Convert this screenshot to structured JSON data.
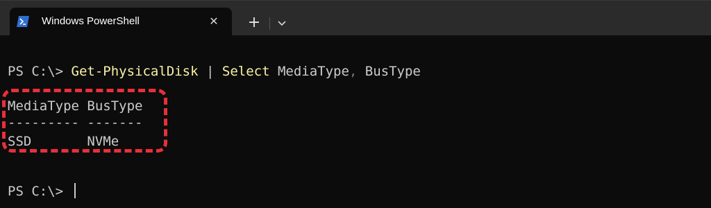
{
  "window": {
    "tab": {
      "title": "Windows PowerShell",
      "icon": "powershell-icon",
      "close_glyph": "✕"
    },
    "new_tab_glyph": "+",
    "dropdown_icon": "chevron-down-icon"
  },
  "terminal": {
    "command_line": {
      "prompt": "PS C:\\> ",
      "cmdlet": "Get-PhysicalDisk",
      "pipe": " | ",
      "select_cmdlet": "Select",
      "params": " MediaType",
      "comma": ",",
      "params2": " BusType"
    },
    "output": {
      "header": "MediaType BusType",
      "separator": "--------- -------",
      "row": "SSD       NVMe"
    },
    "second_prompt": "PS C:\\> "
  },
  "colors": {
    "background": "#0c0c0c",
    "tabbar": "#2b2b2b",
    "cmdlet": "#f9f1a5",
    "text": "#cccccc",
    "highlight": "#e8303a"
  }
}
